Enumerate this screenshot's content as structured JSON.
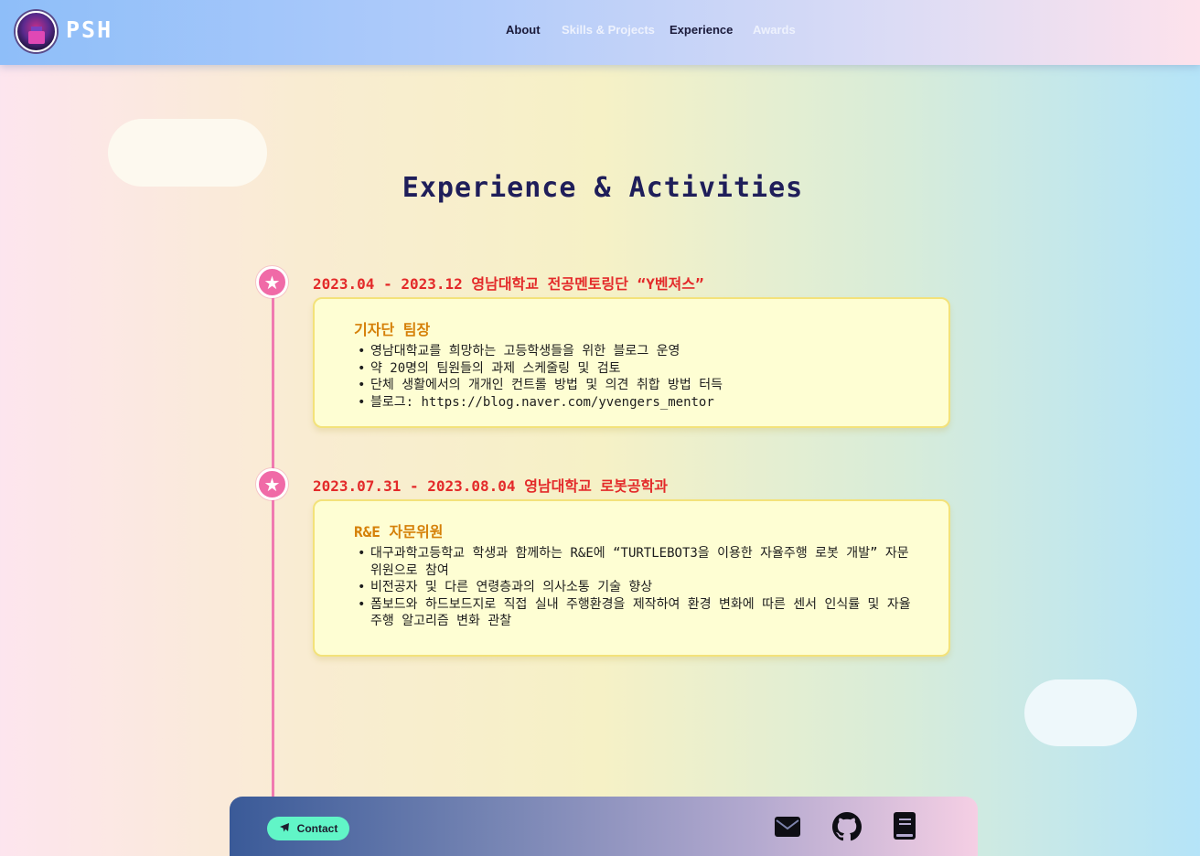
{
  "header": {
    "logo_text": "PSH",
    "nav": [
      {
        "label": "About"
      },
      {
        "label": "Skills & Projects"
      },
      {
        "label": "Experience"
      },
      {
        "label": "Awards"
      }
    ]
  },
  "page": {
    "title": "Experience & Activities"
  },
  "entries": [
    {
      "title": "2023.04 - 2023.12 영남대학교 전공멘토링단 “Y벤져스”",
      "role": "기자단 팀장",
      "bullets": [
        "영남대학교를 희망하는 고등학생들을 위한 블로그 운영",
        "약 20명의 팀원들의 과제 스케줄링 및 검토",
        "단체 생활에서의 개개인 컨트롤 방법 및 의견 취합 방법 터득",
        "블로그: https://blog.naver.com/yvengers_mentor"
      ]
    },
    {
      "title": "2023.07.31 - 2023.08.04 영남대학교 로봇공학과",
      "role": "R&E 자문위원",
      "bullets": [
        "대구과학고등학교 학생과 함께하는 R&E에 “TURTLEBOT3을 이용한 자율주행 로봇 개발” 자문위원으로 참여",
        "비전공자 및 다른 연령층과의 의사소통 기술 향상",
        "폼보드와 하드보드지로 직접 실내 주행환경을 제작하여 환경 변화에 따른 센서 인식률 및 자율주행 알고리즘 변화 관찰"
      ]
    }
  ],
  "footer": {
    "contact_label": "Contact",
    "icons": [
      "envelope-icon",
      "github-icon",
      "book-icon"
    ]
  },
  "colors": {
    "accent_pink": "#f06aa7",
    "entry_title_red": "#e32a2a",
    "role_orange": "#d58008",
    "card_bg": "#fefed3",
    "contact_green": "#61f5c7"
  }
}
